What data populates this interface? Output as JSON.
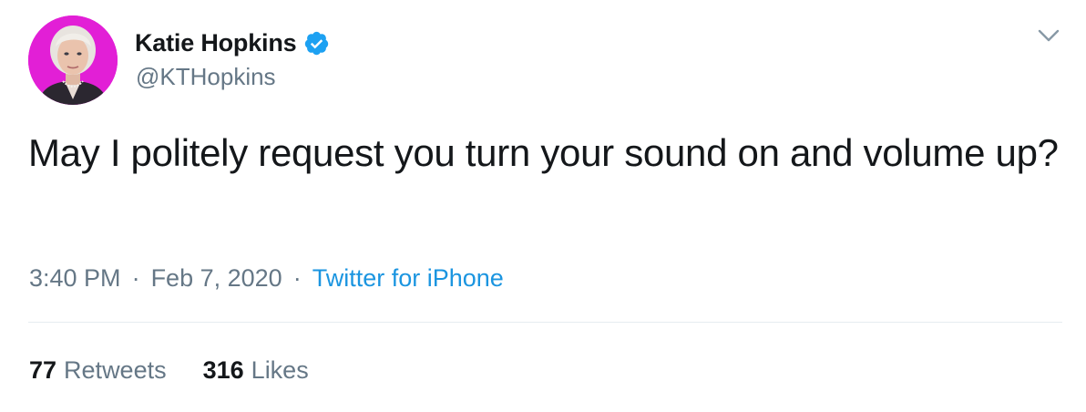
{
  "user": {
    "display_name": "Katie Hopkins",
    "handle": "@KTHopkins",
    "verified": true,
    "avatar_bg_color": "#e21fd6"
  },
  "tweet": {
    "text": "May I politely request you turn your sound on and volume up?",
    "time": "3:40 PM",
    "date": "Feb 7, 2020",
    "source": "Twitter for iPhone"
  },
  "stats": {
    "retweets_count": "77",
    "retweets_label": "Retweets",
    "likes_count": "316",
    "likes_label": "Likes"
  },
  "colors": {
    "text_primary": "#14171a",
    "text_secondary": "#657786",
    "link": "#1b95e0",
    "verified": "#1da1f2",
    "divider": "#e6ecf0"
  },
  "icons": {
    "verified": "verified-badge-icon",
    "more": "chevron-down-icon"
  }
}
